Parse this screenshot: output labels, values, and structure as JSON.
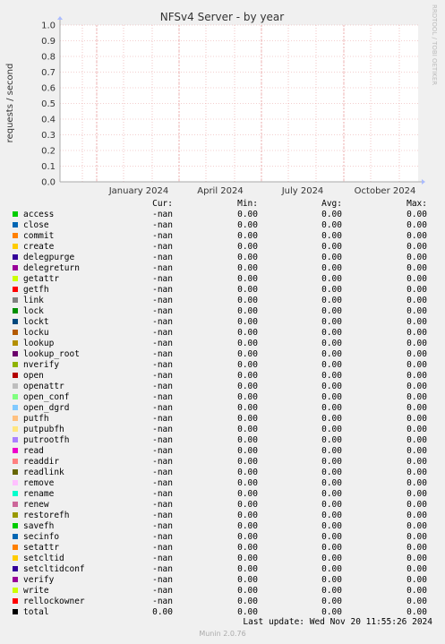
{
  "chart_data": {
    "type": "line",
    "title": "NFSv4 Server - by year",
    "ylabel": "requests / second",
    "side_label": "RRDTOOL / TOBI OETIKER",
    "ylim": [
      0,
      1.0
    ],
    "y_ticks": [
      "0.0",
      "0.1",
      "0.2",
      "0.3",
      "0.4",
      "0.5",
      "0.6",
      "0.7",
      "0.8",
      "0.9",
      "1.0"
    ],
    "x_ticks": [
      "January 2024",
      "April 2024",
      "July 2024",
      "October 2024"
    ],
    "grid": true,
    "series_values": "-nan"
  },
  "legend": {
    "headers": {
      "cur": "Cur:",
      "min": "Min:",
      "avg": "Avg:",
      "max": "Max:"
    },
    "rows": [
      {
        "name": "access",
        "color": "#00cc00",
        "cur": "-nan",
        "min": "0.00",
        "avg": "0.00",
        "max": "0.00"
      },
      {
        "name": "close",
        "color": "#0066b3",
        "cur": "-nan",
        "min": "0.00",
        "avg": "0.00",
        "max": "0.00"
      },
      {
        "name": "commit",
        "color": "#ff8000",
        "cur": "-nan",
        "min": "0.00",
        "avg": "0.00",
        "max": "0.00"
      },
      {
        "name": "create",
        "color": "#ffcc00",
        "cur": "-nan",
        "min": "0.00",
        "avg": "0.00",
        "max": "0.00"
      },
      {
        "name": "delegpurge",
        "color": "#330099",
        "cur": "-nan",
        "min": "0.00",
        "avg": "0.00",
        "max": "0.00"
      },
      {
        "name": "delegreturn",
        "color": "#990099",
        "cur": "-nan",
        "min": "0.00",
        "avg": "0.00",
        "max": "0.00"
      },
      {
        "name": "getattr",
        "color": "#ccff00",
        "cur": "-nan",
        "min": "0.00",
        "avg": "0.00",
        "max": "0.00"
      },
      {
        "name": "getfh",
        "color": "#ff0000",
        "cur": "-nan",
        "min": "0.00",
        "avg": "0.00",
        "max": "0.00"
      },
      {
        "name": "link",
        "color": "#808080",
        "cur": "-nan",
        "min": "0.00",
        "avg": "0.00",
        "max": "0.00"
      },
      {
        "name": "lock",
        "color": "#008f00",
        "cur": "-nan",
        "min": "0.00",
        "avg": "0.00",
        "max": "0.00"
      },
      {
        "name": "lockt",
        "color": "#00487d",
        "cur": "-nan",
        "min": "0.00",
        "avg": "0.00",
        "max": "0.00"
      },
      {
        "name": "locku",
        "color": "#b35a00",
        "cur": "-nan",
        "min": "0.00",
        "avg": "0.00",
        "max": "0.00"
      },
      {
        "name": "lookup",
        "color": "#b38f00",
        "cur": "-nan",
        "min": "0.00",
        "avg": "0.00",
        "max": "0.00"
      },
      {
        "name": "lookup_root",
        "color": "#6b006b",
        "cur": "-nan",
        "min": "0.00",
        "avg": "0.00",
        "max": "0.00"
      },
      {
        "name": "nverify",
        "color": "#8fb300",
        "cur": "-nan",
        "min": "0.00",
        "avg": "0.00",
        "max": "0.00"
      },
      {
        "name": "open",
        "color": "#b30000",
        "cur": "-nan",
        "min": "0.00",
        "avg": "0.00",
        "max": "0.00"
      },
      {
        "name": "openattr",
        "color": "#bebebe",
        "cur": "-nan",
        "min": "0.00",
        "avg": "0.00",
        "max": "0.00"
      },
      {
        "name": "open_conf",
        "color": "#80ff80",
        "cur": "-nan",
        "min": "0.00",
        "avg": "0.00",
        "max": "0.00"
      },
      {
        "name": "open_dgrd",
        "color": "#80c9ff",
        "cur": "-nan",
        "min": "0.00",
        "avg": "0.00",
        "max": "0.00"
      },
      {
        "name": "putfh",
        "color": "#ffc080",
        "cur": "-nan",
        "min": "0.00",
        "avg": "0.00",
        "max": "0.00"
      },
      {
        "name": "putpubfh",
        "color": "#ffe680",
        "cur": "-nan",
        "min": "0.00",
        "avg": "0.00",
        "max": "0.00"
      },
      {
        "name": "putrootfh",
        "color": "#aa80ff",
        "cur": "-nan",
        "min": "0.00",
        "avg": "0.00",
        "max": "0.00"
      },
      {
        "name": "read",
        "color": "#ee00cc",
        "cur": "-nan",
        "min": "0.00",
        "avg": "0.00",
        "max": "0.00"
      },
      {
        "name": "readdir",
        "color": "#ff8080",
        "cur": "-nan",
        "min": "0.00",
        "avg": "0.00",
        "max": "0.00"
      },
      {
        "name": "readlink",
        "color": "#666600",
        "cur": "-nan",
        "min": "0.00",
        "avg": "0.00",
        "max": "0.00"
      },
      {
        "name": "remove",
        "color": "#ffbfff",
        "cur": "-nan",
        "min": "0.00",
        "avg": "0.00",
        "max": "0.00"
      },
      {
        "name": "rename",
        "color": "#00ffcc",
        "cur": "-nan",
        "min": "0.00",
        "avg": "0.00",
        "max": "0.00"
      },
      {
        "name": "renew",
        "color": "#cc6699",
        "cur": "-nan",
        "min": "0.00",
        "avg": "0.00",
        "max": "0.00"
      },
      {
        "name": "restorefh",
        "color": "#999900",
        "cur": "-nan",
        "min": "0.00",
        "avg": "0.00",
        "max": "0.00"
      },
      {
        "name": "savefh",
        "color": "#00cc00",
        "cur": "-nan",
        "min": "0.00",
        "avg": "0.00",
        "max": "0.00"
      },
      {
        "name": "secinfo",
        "color": "#0066b3",
        "cur": "-nan",
        "min": "0.00",
        "avg": "0.00",
        "max": "0.00"
      },
      {
        "name": "setattr",
        "color": "#ff8000",
        "cur": "-nan",
        "min": "0.00",
        "avg": "0.00",
        "max": "0.00"
      },
      {
        "name": "setcltid",
        "color": "#ffcc00",
        "cur": "-nan",
        "min": "0.00",
        "avg": "0.00",
        "max": "0.00"
      },
      {
        "name": "setcltidconf",
        "color": "#330099",
        "cur": "-nan",
        "min": "0.00",
        "avg": "0.00",
        "max": "0.00"
      },
      {
        "name": "verify",
        "color": "#990099",
        "cur": "-nan",
        "min": "0.00",
        "avg": "0.00",
        "max": "0.00"
      },
      {
        "name": "write",
        "color": "#ccff00",
        "cur": "-nan",
        "min": "0.00",
        "avg": "0.00",
        "max": "0.00"
      },
      {
        "name": "rellockowner",
        "color": "#ff0000",
        "cur": "-nan",
        "min": "0.00",
        "avg": "0.00",
        "max": "0.00"
      },
      {
        "name": "total",
        "color": "#000000",
        "cur": "0.00",
        "min": "0.00",
        "avg": "0.00",
        "max": "0.00"
      }
    ]
  },
  "footer": {
    "last_update": "Last update: Wed Nov 20 11:55:26 2024",
    "version": "Munin 2.0.76"
  }
}
